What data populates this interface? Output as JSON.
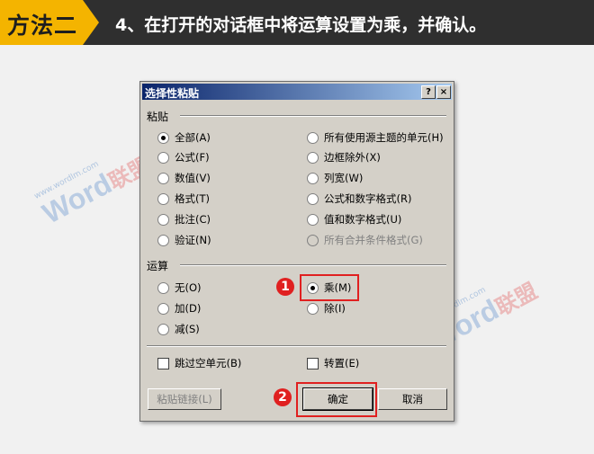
{
  "banner": {
    "badge": "方法二",
    "step": "4、在打开的对话框中将运算设置为乘，并确认。",
    "badge_color": "#f4b400",
    "bar_color": "#2f2f2f"
  },
  "watermark": {
    "word": "Word",
    "lian": "联盟",
    "url": "www.wordlm.com"
  },
  "dialog": {
    "title": "选择性粘贴",
    "help": "?",
    "close": "×",
    "paste_group": "粘贴",
    "paste_options": [
      {
        "label": "全部(A)",
        "checked": true,
        "disabled": false
      },
      {
        "label": "公式(F)",
        "checked": false,
        "disabled": false
      },
      {
        "label": "数值(V)",
        "checked": false,
        "disabled": false
      },
      {
        "label": "格式(T)",
        "checked": false,
        "disabled": false
      },
      {
        "label": "批注(C)",
        "checked": false,
        "disabled": false
      },
      {
        "label": "验证(N)",
        "checked": false,
        "disabled": false
      },
      {
        "label": "所有使用源主题的单元(H)",
        "checked": false,
        "disabled": false
      },
      {
        "label": "边框除外(X)",
        "checked": false,
        "disabled": false
      },
      {
        "label": "列宽(W)",
        "checked": false,
        "disabled": false
      },
      {
        "label": "公式和数字格式(R)",
        "checked": false,
        "disabled": false
      },
      {
        "label": "值和数字格式(U)",
        "checked": false,
        "disabled": false
      },
      {
        "label": "所有合并条件格式(G)",
        "checked": false,
        "disabled": true
      }
    ],
    "operation_group": "运算",
    "operation_options": [
      {
        "label": "无(O)",
        "checked": false
      },
      {
        "label": "加(D)",
        "checked": false
      },
      {
        "label": "减(S)",
        "checked": false
      },
      {
        "label": "乘(M)",
        "checked": true
      },
      {
        "label": "除(I)",
        "checked": false
      }
    ],
    "skip_blanks": {
      "label": "跳过空单元(B)",
      "checked": false
    },
    "transpose": {
      "label": "转置(E)",
      "checked": false
    },
    "paste_link": "粘贴链接(L)",
    "ok": "确定",
    "cancel": "取消"
  },
  "callouts": [
    "1",
    "2"
  ],
  "highlight_color": "#e02020"
}
